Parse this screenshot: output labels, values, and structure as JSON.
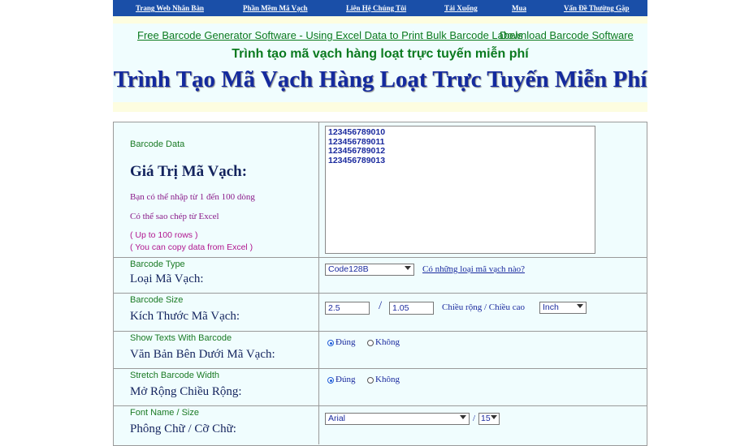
{
  "nav": {
    "items": [
      {
        "label": "Trang Web Nhãn Bàn"
      },
      {
        "label": "Phần Mềm Mã Vạch"
      },
      {
        "label": "Liên Hệ Chúng Tôi"
      },
      {
        "label": "Tải Xuống"
      },
      {
        "label": "Mua"
      },
      {
        "label": "Vấn Đề Thường Gặp"
      }
    ]
  },
  "header": {
    "link_software": "Free Barcode Generator Software - Using Excel Data to Print Bulk Barcode Labels",
    "link_download": "Download Barcode Software",
    "subtitle": "Trình tạo mã vạch hàng loạt trực tuyến miễn phí",
    "title": "Trình Tạo Mã Vạch Hàng Loạt Trực Tuyến Miễn Phí"
  },
  "form": {
    "data_row": {
      "label_en": "Barcode Data",
      "label_vi": "Giá Trị Mã Vạch:",
      "hint1": "Bạn có thể nhập từ 1 đến 100 dòng",
      "hint2": "Có thể sao chép từ Excel",
      "hint3": "( Up to 100 rows )",
      "hint4": "( You can copy data from Excel )",
      "value": "123456789010\n123456789011\n123456789012\n123456789013"
    },
    "type_row": {
      "label_en": "Barcode Type",
      "label_vi": "Loại Mã Vạch:",
      "selected": "Code128B",
      "help_link": "Có những loại mã vạch nào?"
    },
    "size_row": {
      "label_en": "Barcode Size",
      "label_vi": "Kích Thước Mã Vạch:",
      "width": "2.5",
      "separator": "/",
      "height": "1.05",
      "hint": "Chiều rộng / Chiều cao",
      "unit": "Inch"
    },
    "text_row": {
      "label_en": "Show Texts With Barcode",
      "label_vi": "Văn Bản Bên Dưới Mã Vạch:",
      "yes": "Đúng",
      "no": "Không",
      "selected": "yes"
    },
    "stretch_row": {
      "label_en": "Stretch Barcode Width",
      "label_vi": "Mở Rộng Chiều Rộng:",
      "yes": "Đúng",
      "no": "Không",
      "selected": "yes"
    },
    "font_row": {
      "label_en": "Font Name / Size",
      "label_vi": "Phông Chữ / Cỡ Chữ:",
      "font": "Arial",
      "separator": "/",
      "size": "15"
    }
  }
}
